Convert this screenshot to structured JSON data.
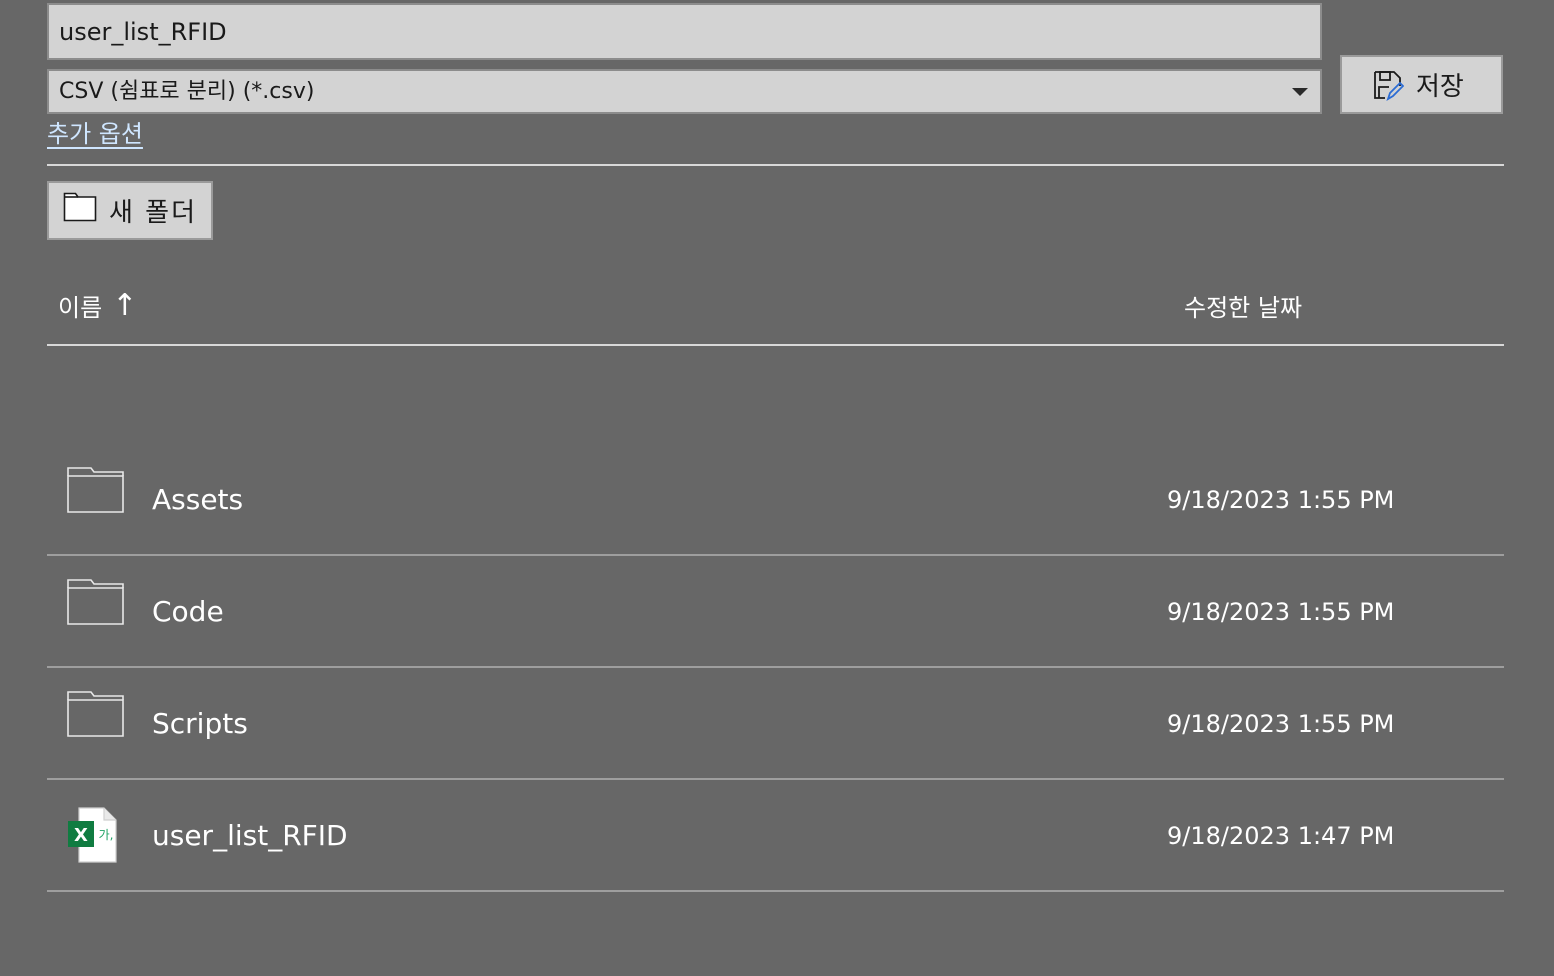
{
  "filename": {
    "value": "user_list_RFID"
  },
  "filetype": {
    "selected": "CSV (쉼표로 분리) (*.csv)"
  },
  "save_button": {
    "label": "저장",
    "icon": "save-as-icon"
  },
  "more_options": {
    "label": "추가 옵션"
  },
  "new_folder_button": {
    "label": "새 폴더",
    "icon": "folder-icon"
  },
  "columns": {
    "name": "이름",
    "sort_indicator": "↑",
    "modified": "수정한 날짜"
  },
  "files": [
    {
      "name": "Assets",
      "type": "folder",
      "icon": "folder-icon",
      "modified": "9/18/2023 1:55 PM"
    },
    {
      "name": "Code",
      "type": "folder",
      "icon": "folder-icon",
      "modified": "9/18/2023 1:55 PM"
    },
    {
      "name": "Scripts",
      "type": "folder",
      "icon": "folder-icon",
      "modified": "9/18/2023 1:55 PM"
    },
    {
      "name": "user_list_RFID",
      "type": "csv",
      "icon": "excel-csv-file-icon",
      "icon_text": "X",
      "icon_subtext": "가,",
      "modified": "9/18/2023 1:47 PM"
    }
  ],
  "colors": {
    "background": "#676767",
    "field": "#d3d3d3",
    "link": "#cfe6ff",
    "excel_green": "#107c41"
  }
}
